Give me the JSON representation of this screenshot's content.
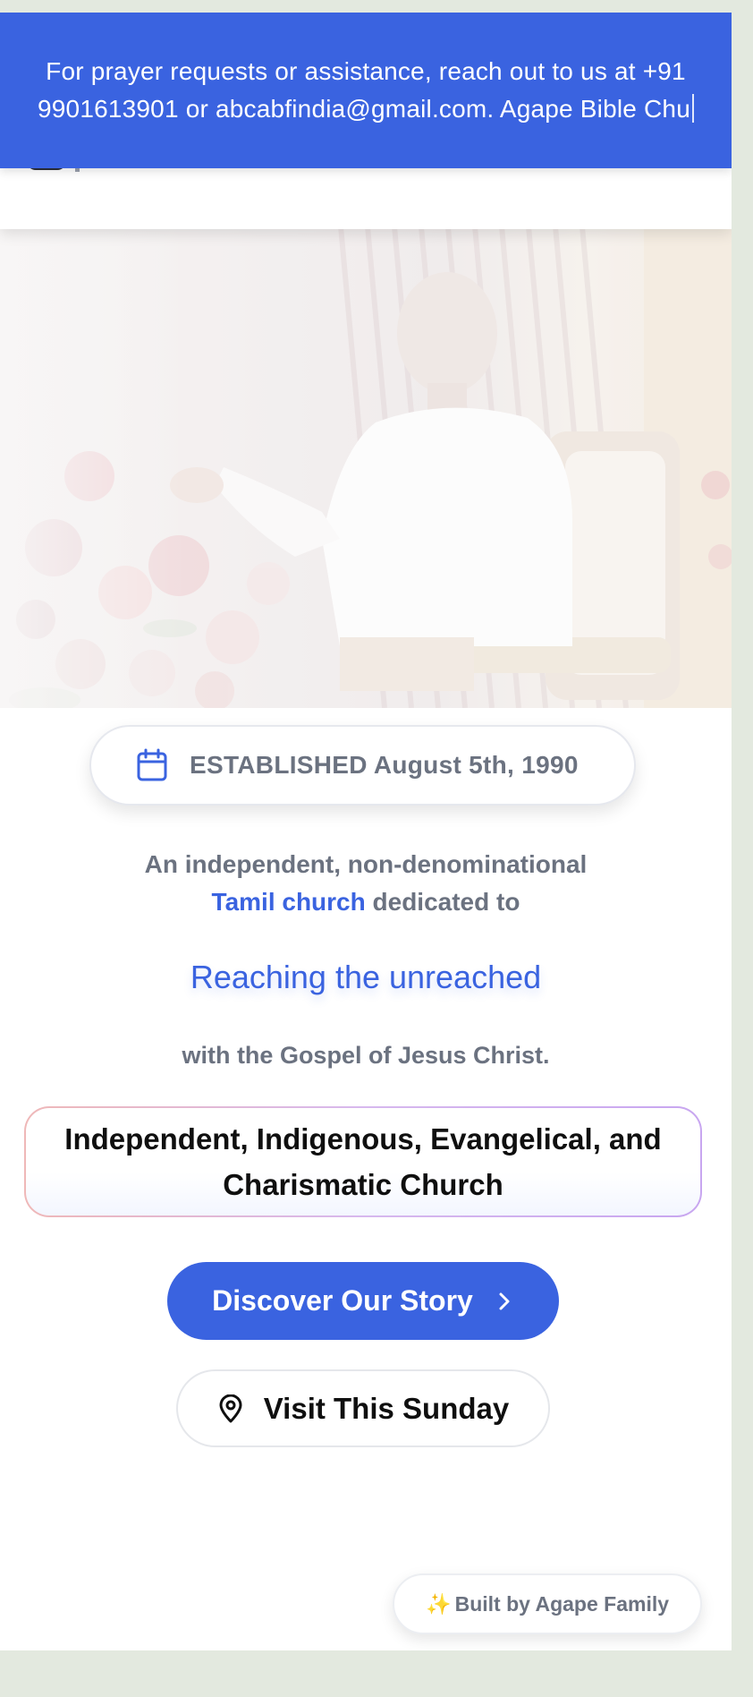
{
  "announcement": {
    "text": "For prayer requests or assistance, reach out to us at +91 9901613901 or abcabfindia@gmail.com. Agape Bible Chu"
  },
  "hero": {
    "image_icon": "preacher-photo"
  },
  "established": {
    "icon": "calendar-icon",
    "text": "ESTABLISHED August 5th, 1990"
  },
  "intro": {
    "line1": "An independent, non-denominational",
    "highlight": "Tamil church",
    "line2_rest": " dedicated to"
  },
  "tagline": "Reaching the unreached",
  "gospel_line": "with the Gospel of Jesus Christ.",
  "identity": "Independent, Indigenous, Evangelical, and Charismatic Church",
  "buttons": {
    "discover": "Discover Our Story",
    "discover_icon": "chevron-right-icon",
    "visit": "Visit This Sunday",
    "visit_icon": "map-pin-icon"
  },
  "badge": {
    "sparkle": "✨",
    "text": "Built by Agape Family"
  },
  "colors": {
    "accent": "#3a63e0",
    "muted_text": "#6b7280",
    "page_bg": "#e3e9df"
  }
}
